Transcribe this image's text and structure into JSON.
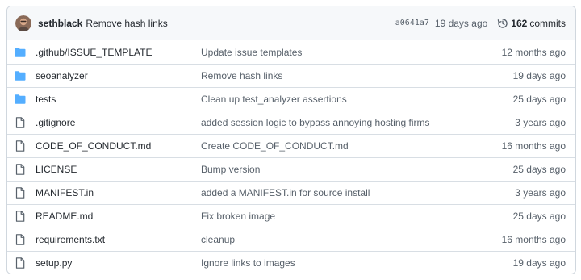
{
  "latest_commit": {
    "author": "sethblack",
    "message": "Remove hash links",
    "sha": "a0641a7",
    "age": "19 days ago",
    "commit_count": "162",
    "commits_label": "commits"
  },
  "files": [
    {
      "type": "folder",
      "name": ".github/ISSUE_TEMPLATE",
      "message": "Update issue templates",
      "age": "12 months ago"
    },
    {
      "type": "folder",
      "name": "seoanalyzer",
      "message": "Remove hash links",
      "age": "19 days ago"
    },
    {
      "type": "folder",
      "name": "tests",
      "message": "Clean up test_analyzer assertions",
      "age": "25 days ago"
    },
    {
      "type": "file",
      "name": ".gitignore",
      "message": "added session logic to bypass annoying hosting firms",
      "age": "3 years ago"
    },
    {
      "type": "file",
      "name": "CODE_OF_CONDUCT.md",
      "message": "Create CODE_OF_CONDUCT.md",
      "age": "16 months ago"
    },
    {
      "type": "file",
      "name": "LICENSE",
      "message": "Bump version",
      "age": "25 days ago"
    },
    {
      "type": "file",
      "name": "MANIFEST.in",
      "message": "added a MANIFEST.in for source install",
      "age": "3 years ago"
    },
    {
      "type": "file",
      "name": "README.md",
      "message": "Fix broken image",
      "age": "25 days ago"
    },
    {
      "type": "file",
      "name": "requirements.txt",
      "message": "cleanup",
      "age": "16 months ago"
    },
    {
      "type": "file",
      "name": "setup.py",
      "message": "Ignore links to images",
      "age": "19 days ago"
    }
  ],
  "colors": {
    "folder_icon": "#54aeff",
    "file_icon": "#57606a",
    "header_bg": "#f6f8fa",
    "border": "#d0d7de"
  }
}
